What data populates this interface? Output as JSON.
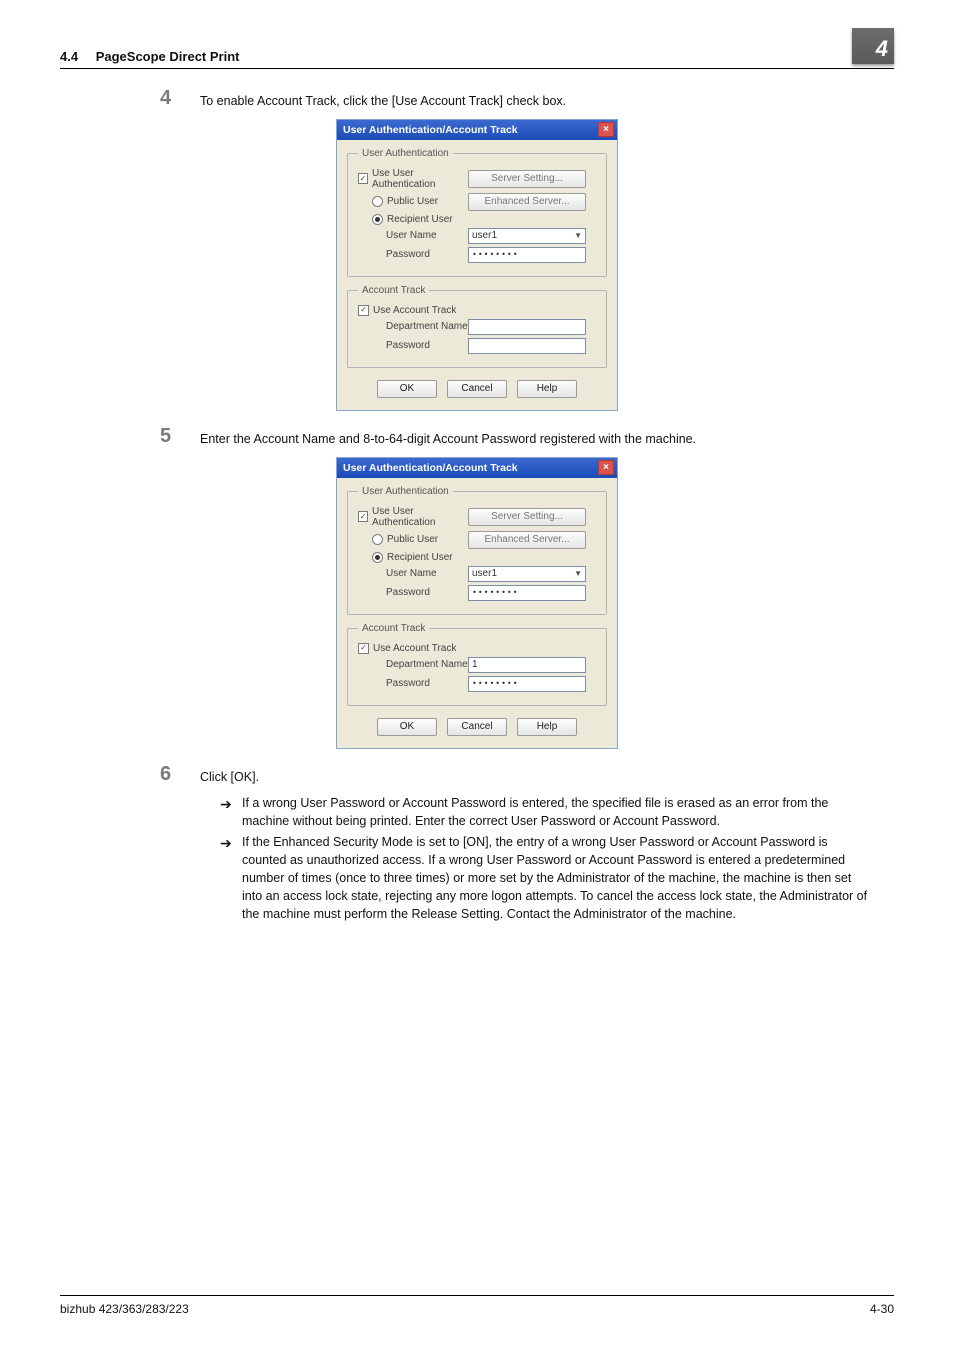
{
  "header": {
    "section_num": "4.4",
    "section_title": "PageScope Direct Print",
    "chapter_num": "4"
  },
  "step4": {
    "num": "4",
    "text": "To enable Account Track, click the [Use Account Track] check box."
  },
  "step5": {
    "num": "5",
    "text": "Enter the Account Name and 8-to-64-digit Account Password registered with the machine."
  },
  "step6": {
    "num": "6",
    "text": "Click [OK]."
  },
  "bullets": {
    "b1": "If a wrong User Password or Account Password is entered, the specified file is erased as an error from the machine without being printed. Enter the correct User Password or Account Password.",
    "b2": "If the Enhanced Security Mode is set to [ON], the entry of a wrong User Password or Account Password is counted as unauthorized access. If a wrong User Password or Account Password is entered a predetermined number of times (once to three times) or more set by the Administrator of the machine, the machine is then set into an access lock state, rejecting any more logon attempts. To cancel the access lock state, the Administrator of the machine must perform the Release Setting. Contact the Administrator of the machine."
  },
  "dialog": {
    "title": "User Authentication/Account Track",
    "ua_legend": "User Authentication",
    "use_user_auth": "Use User Authentication",
    "server_setting": "Server Setting...",
    "public_user": "Public User",
    "enhanced_server": "Enhanced Server...",
    "recipient_user": "Recipient User",
    "user_name_lbl": "User Name",
    "user_name_val": "user1",
    "password_lbl": "Password",
    "password_mask": "••••••••",
    "at_legend": "Account Track",
    "use_account_track": "Use Account Track",
    "dept_name_lbl": "Department Name",
    "at_password_lbl": "Password",
    "ok": "OK",
    "cancel": "Cancel",
    "help": "Help"
  },
  "dialog2": {
    "dept_name_val": "1",
    "at_password_mask": "••••••••"
  },
  "footer": {
    "model": "bizhub 423/363/283/223",
    "page": "4-30"
  }
}
